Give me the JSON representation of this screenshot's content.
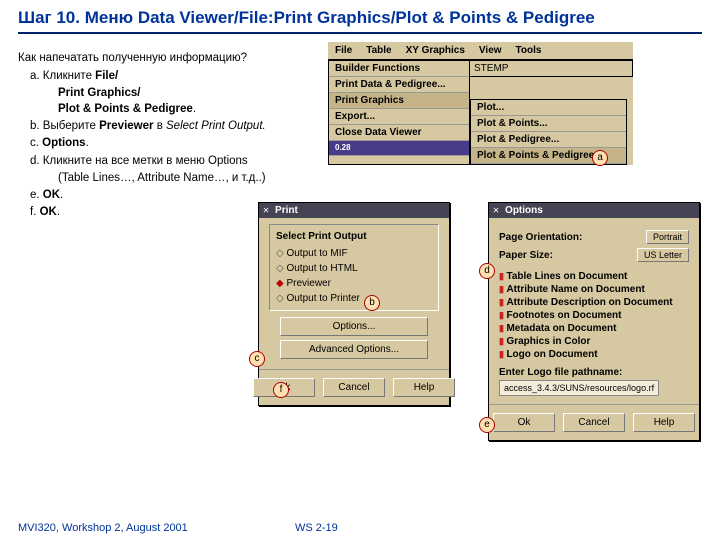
{
  "title": "Шаг 10.  Меню Data Viewer/File:Print Graphics/Plot & Points & Pedigree",
  "question": "Как напечатать полученную информацию?",
  "steps": {
    "a": "Кликните ",
    "a_b1": "File/",
    "a_b2": "Print Graphics/",
    "a_b3": "Plot & Points & Pedigree",
    "b": "Выберите ",
    "b_b": "Previewer",
    "b_t": " в ",
    "b_i": "Select Print Output.",
    "c": "Options",
    "c_t": ".",
    "d": "Кликните на все метки в меню Options",
    "d2": "(Table Lines…, Attribute Name…, и т.д..)",
    "e": "OK",
    "e_t": ".",
    "f": "OK",
    "f_t": "."
  },
  "menu": {
    "bar": [
      "File",
      "Table",
      "XY Graphics",
      "View",
      "Tools"
    ],
    "sub1": [
      "Builder Functions",
      "Print Data & Pedigree...",
      "Print Graphics",
      "Export...",
      "Close Data Viewer"
    ],
    "field": "STEMP",
    "sub2": [
      "Plot...",
      "Plot & Points...",
      "Plot & Pedigree...",
      "Plot & Points & Pedigree..."
    ],
    "footnum": "0.28"
  },
  "print": {
    "title": "Print",
    "group": "Select Print Output",
    "opts": [
      "Output to MIF",
      "Output to HTML",
      "Previewer",
      "Output to Printer"
    ],
    "sel": 2,
    "buttons": [
      "Options...",
      "Advanced Options..."
    ],
    "ok": "Ok",
    "cancel": "Cancel",
    "help": "Help"
  },
  "options": {
    "title": "Options",
    "po_l": "Page Orientation:",
    "po_v": "Portrait",
    "ps_l": "Paper Size:",
    "ps_v": "US Letter",
    "cks": [
      "Table Lines on Document",
      "Attribute Name on Document",
      "Attribute Description on Document",
      "Footnotes on Document",
      "Metadata on Document",
      "Graphics in Color",
      "Logo on Document"
    ],
    "logo_l": "Enter Logo file pathname:",
    "logo_v": "access_3.4.3/SUNS/resources/logo.rf",
    "ok": "Ok",
    "cancel": "Cancel",
    "help": "Help"
  },
  "tags": {
    "a": "a",
    "b": "b",
    "c": "c",
    "d": "d",
    "e": "e",
    "f": "f"
  },
  "footer": {
    "l": "MVI320, Workshop 2, August 2001",
    "c": "WS 2-19"
  }
}
